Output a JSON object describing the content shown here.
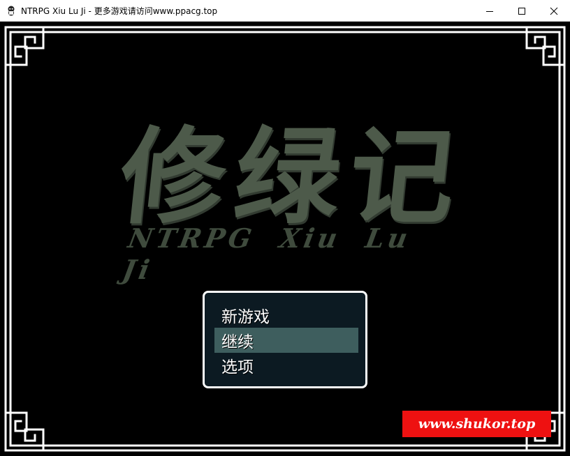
{
  "window": {
    "title": "NTRPG Xiu Lu Ji - 更多游戏请访问www.ppacg.top",
    "controls": [
      "minimize-icon",
      "maximize-icon",
      "close-icon"
    ]
  },
  "game": {
    "logo_text": "修绿记",
    "subtitle": "NTRPG Xiu Lu Ji",
    "logo_color": "#4d5a4a",
    "frame_color": "#ffffff",
    "background_color": "#000000"
  },
  "menu": {
    "items": [
      {
        "label": "新游戏",
        "selected": false
      },
      {
        "label": "继续",
        "selected": true
      },
      {
        "label": "选项",
        "selected": false
      }
    ],
    "selected_index": 1,
    "window_color": "#0c1a22",
    "highlight_color": "#3e5e5e"
  },
  "watermark": {
    "text": "www.shukor.top",
    "color": "#ee1111"
  }
}
